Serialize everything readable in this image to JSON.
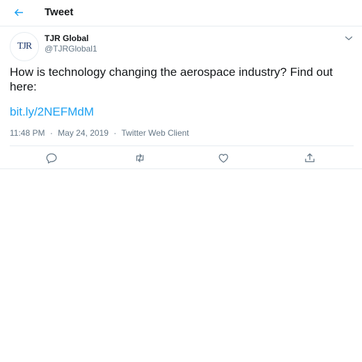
{
  "header": {
    "title": "Tweet",
    "back_icon": "arrow-left-icon"
  },
  "tweet": {
    "author": {
      "display_name": "TJR Global",
      "handle": "@TJRGlobal1",
      "avatar_text": "TJR"
    },
    "text": "How is technology changing the aerospace industry? Find out here:",
    "link": "bit.ly/2NEFMdM",
    "time": "11:48 PM",
    "date": "May 24, 2019",
    "client": "Twitter Web Client",
    "separator": "·",
    "menu_icon": "chevron-down-icon"
  },
  "actions": [
    {
      "name": "reply",
      "icon": "reply-icon"
    },
    {
      "name": "retweet",
      "icon": "retweet-icon"
    },
    {
      "name": "like",
      "icon": "heart-icon"
    },
    {
      "name": "share",
      "icon": "share-icon"
    }
  ],
  "colors": {
    "accent": "#1da1f2",
    "text": "#14171a",
    "muted": "#657786",
    "border": "#e6ecf0"
  }
}
